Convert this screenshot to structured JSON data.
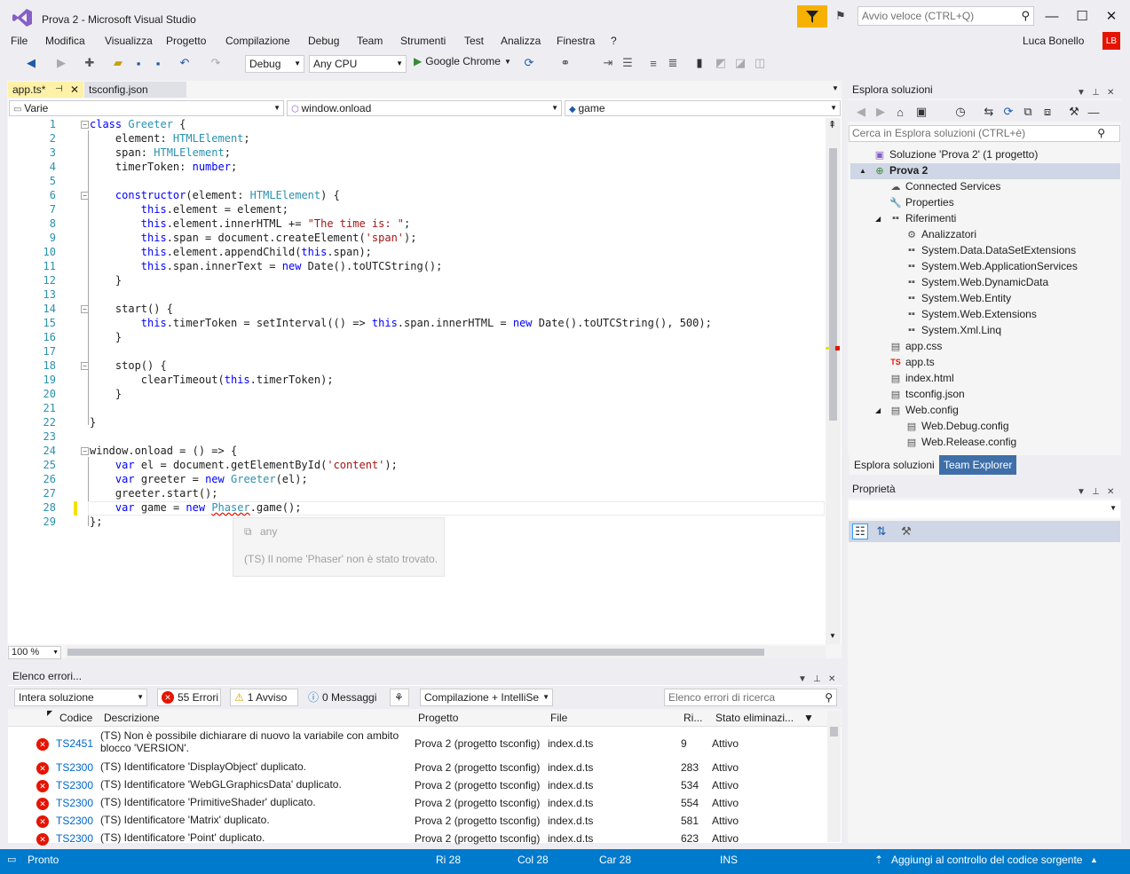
{
  "window": {
    "title": "Prova 2 - Microsoft Visual Studio",
    "quick_launch_placeholder": "Avvio veloce (CTRL+Q)",
    "user": "Luca Bonello",
    "avatar_initials": "LB",
    "accent": "#f6b100"
  },
  "menu": [
    "File",
    "Modifica",
    "Visualizza",
    "Progetto",
    "Compilazione",
    "Debug",
    "Team",
    "Strumenti",
    "Test",
    "Analizza",
    "Finestra",
    "?"
  ],
  "toolbar": {
    "config": "Debug",
    "platform": "Any CPU",
    "run_target": "Google Chrome"
  },
  "tabs": [
    {
      "label": "app.ts*",
      "active": true
    },
    {
      "label": "tsconfig.json",
      "active": false
    }
  ],
  "navbar": {
    "scope": "Varie",
    "member": "window.onload",
    "symbol": "game"
  },
  "code": [
    "class Greeter {",
    "    element: HTMLElement;",
    "    span: HTMLElement;",
    "    timerToken: number;",
    "",
    "    constructor(element: HTMLElement) {",
    "        this.element = element;",
    "        this.element.innerHTML += \"The time is: \";",
    "        this.span = document.createElement('span');",
    "        this.element.appendChild(this.span);",
    "        this.span.innerText = new Date().toUTCString();",
    "    }",
    "",
    "    start() {",
    "        this.timerToken = setInterval(() => this.span.innerHTML = new Date().toUTCString(), 500);",
    "    }",
    "",
    "    stop() {",
    "        clearTimeout(this.timerToken);",
    "    }",
    "",
    "}",
    "",
    "window.onload = () => {",
    "    var el = document.getElementById('content');",
    "    var greeter = new Greeter(el);",
    "    greeter.start();",
    "    var game = new Phaser.game();",
    "};"
  ],
  "tooltip": {
    "type": "any",
    "message": "(TS) Il nome 'Phaser' non è stato trovato."
  },
  "zoom": "100 %",
  "error_list": {
    "title": "Elenco errori...",
    "scope": "Intera soluzione",
    "errors_label": "55 Errori",
    "warnings_label": "1 Avviso",
    "messages_label": "0 Messaggi",
    "build_filter": "Compilazione + IntelliSe",
    "search_placeholder": "Elenco errori di ricerca",
    "columns": [
      "Codice",
      "Descrizione",
      "Progetto",
      "File",
      "Ri...",
      "Stato eliminazi..."
    ],
    "rows": [
      {
        "code": "TS2451",
        "desc": "(TS) Non è possibile dichiarare di nuovo la variabile con ambito",
        "desc2": "blocco 'VERSION'.",
        "project": "Prova 2 (progetto tsconfig)",
        "file": "index.d.ts",
        "line": "9",
        "state": "Attivo"
      },
      {
        "code": "TS2300",
        "desc": "(TS) Identificatore 'DisplayObject' duplicato.",
        "desc2": "",
        "project": "Prova 2 (progetto tsconfig)",
        "file": "index.d.ts",
        "line": "283",
        "state": "Attivo"
      },
      {
        "code": "TS2300",
        "desc": "(TS) Identificatore 'WebGLGraphicsData' duplicato.",
        "desc2": "",
        "project": "Prova 2 (progetto tsconfig)",
        "file": "index.d.ts",
        "line": "534",
        "state": "Attivo"
      },
      {
        "code": "TS2300",
        "desc": "(TS) Identificatore 'PrimitiveShader' duplicato.",
        "desc2": "",
        "project": "Prova 2 (progetto tsconfig)",
        "file": "index.d.ts",
        "line": "554",
        "state": "Attivo"
      },
      {
        "code": "TS2300",
        "desc": "(TS) Identificatore 'Matrix' duplicato.",
        "desc2": "",
        "project": "Prova 2 (progetto tsconfig)",
        "file": "index.d.ts",
        "line": "581",
        "state": "Attivo"
      },
      {
        "code": "TS2300",
        "desc": "(TS) Identificatore 'Point' duplicato.",
        "desc2": "",
        "project": "Prova 2 (progetto tsconfig)",
        "file": "index.d.ts",
        "line": "623",
        "state": "Attivo"
      }
    ]
  },
  "solution_explorer": {
    "title": "Esplora soluzioni",
    "search_placeholder": "Cerca in Esplora soluzioni (CTRL+è)",
    "tree": [
      {
        "label": "Soluzione 'Prova 2'  (1 progetto)",
        "depth": 0,
        "icon": "solution-icon",
        "arrow": ""
      },
      {
        "label": "Prova 2",
        "depth": 0,
        "icon": "project-icon",
        "arrow": "▲",
        "bold": true
      },
      {
        "label": "Connected Services",
        "depth": 1,
        "icon": "cloud-icon",
        "arrow": ""
      },
      {
        "label": "Properties",
        "depth": 1,
        "icon": "wrench-icon",
        "arrow": ""
      },
      {
        "label": "Riferimenti",
        "depth": 1,
        "icon": "references-icon",
        "arrow": "◢"
      },
      {
        "label": "Analizzatori",
        "depth": 2,
        "icon": "analyzer-icon",
        "arrow": ""
      },
      {
        "label": "System.Data.DataSetExtensions",
        "depth": 2,
        "icon": "reference-icon",
        "arrow": ""
      },
      {
        "label": "System.Web.ApplicationServices",
        "depth": 2,
        "icon": "reference-icon",
        "arrow": ""
      },
      {
        "label": "System.Web.DynamicData",
        "depth": 2,
        "icon": "reference-icon",
        "arrow": ""
      },
      {
        "label": "System.Web.Entity",
        "depth": 2,
        "icon": "reference-icon",
        "arrow": ""
      },
      {
        "label": "System.Web.Extensions",
        "depth": 2,
        "icon": "reference-icon",
        "arrow": ""
      },
      {
        "label": "System.Xml.Linq",
        "depth": 2,
        "icon": "reference-icon",
        "arrow": ""
      },
      {
        "label": "app.css",
        "depth": 1,
        "icon": "css-file-icon",
        "arrow": ""
      },
      {
        "label": "app.ts",
        "depth": 1,
        "icon": "ts-file-icon",
        "arrow": ""
      },
      {
        "label": "index.html",
        "depth": 1,
        "icon": "html-file-icon",
        "arrow": ""
      },
      {
        "label": "tsconfig.json",
        "depth": 1,
        "icon": "json-file-icon",
        "arrow": ""
      },
      {
        "label": "Web.config",
        "depth": 1,
        "icon": "config-file-icon",
        "arrow": "◢"
      },
      {
        "label": "Web.Debug.config",
        "depth": 2,
        "icon": "config-file-icon",
        "arrow": ""
      },
      {
        "label": "Web.Release.config",
        "depth": 2,
        "icon": "config-file-icon",
        "arrow": ""
      }
    ],
    "tabs": [
      "Esplora soluzioni",
      "Team Explorer"
    ]
  },
  "properties": {
    "title": "Proprietà"
  },
  "status": {
    "ready": "Pronto",
    "row": "Ri 28",
    "col": "Col 28",
    "char": "Car 28",
    "mode": "INS",
    "source_control": "Aggiungi al controllo del codice sorgente"
  }
}
